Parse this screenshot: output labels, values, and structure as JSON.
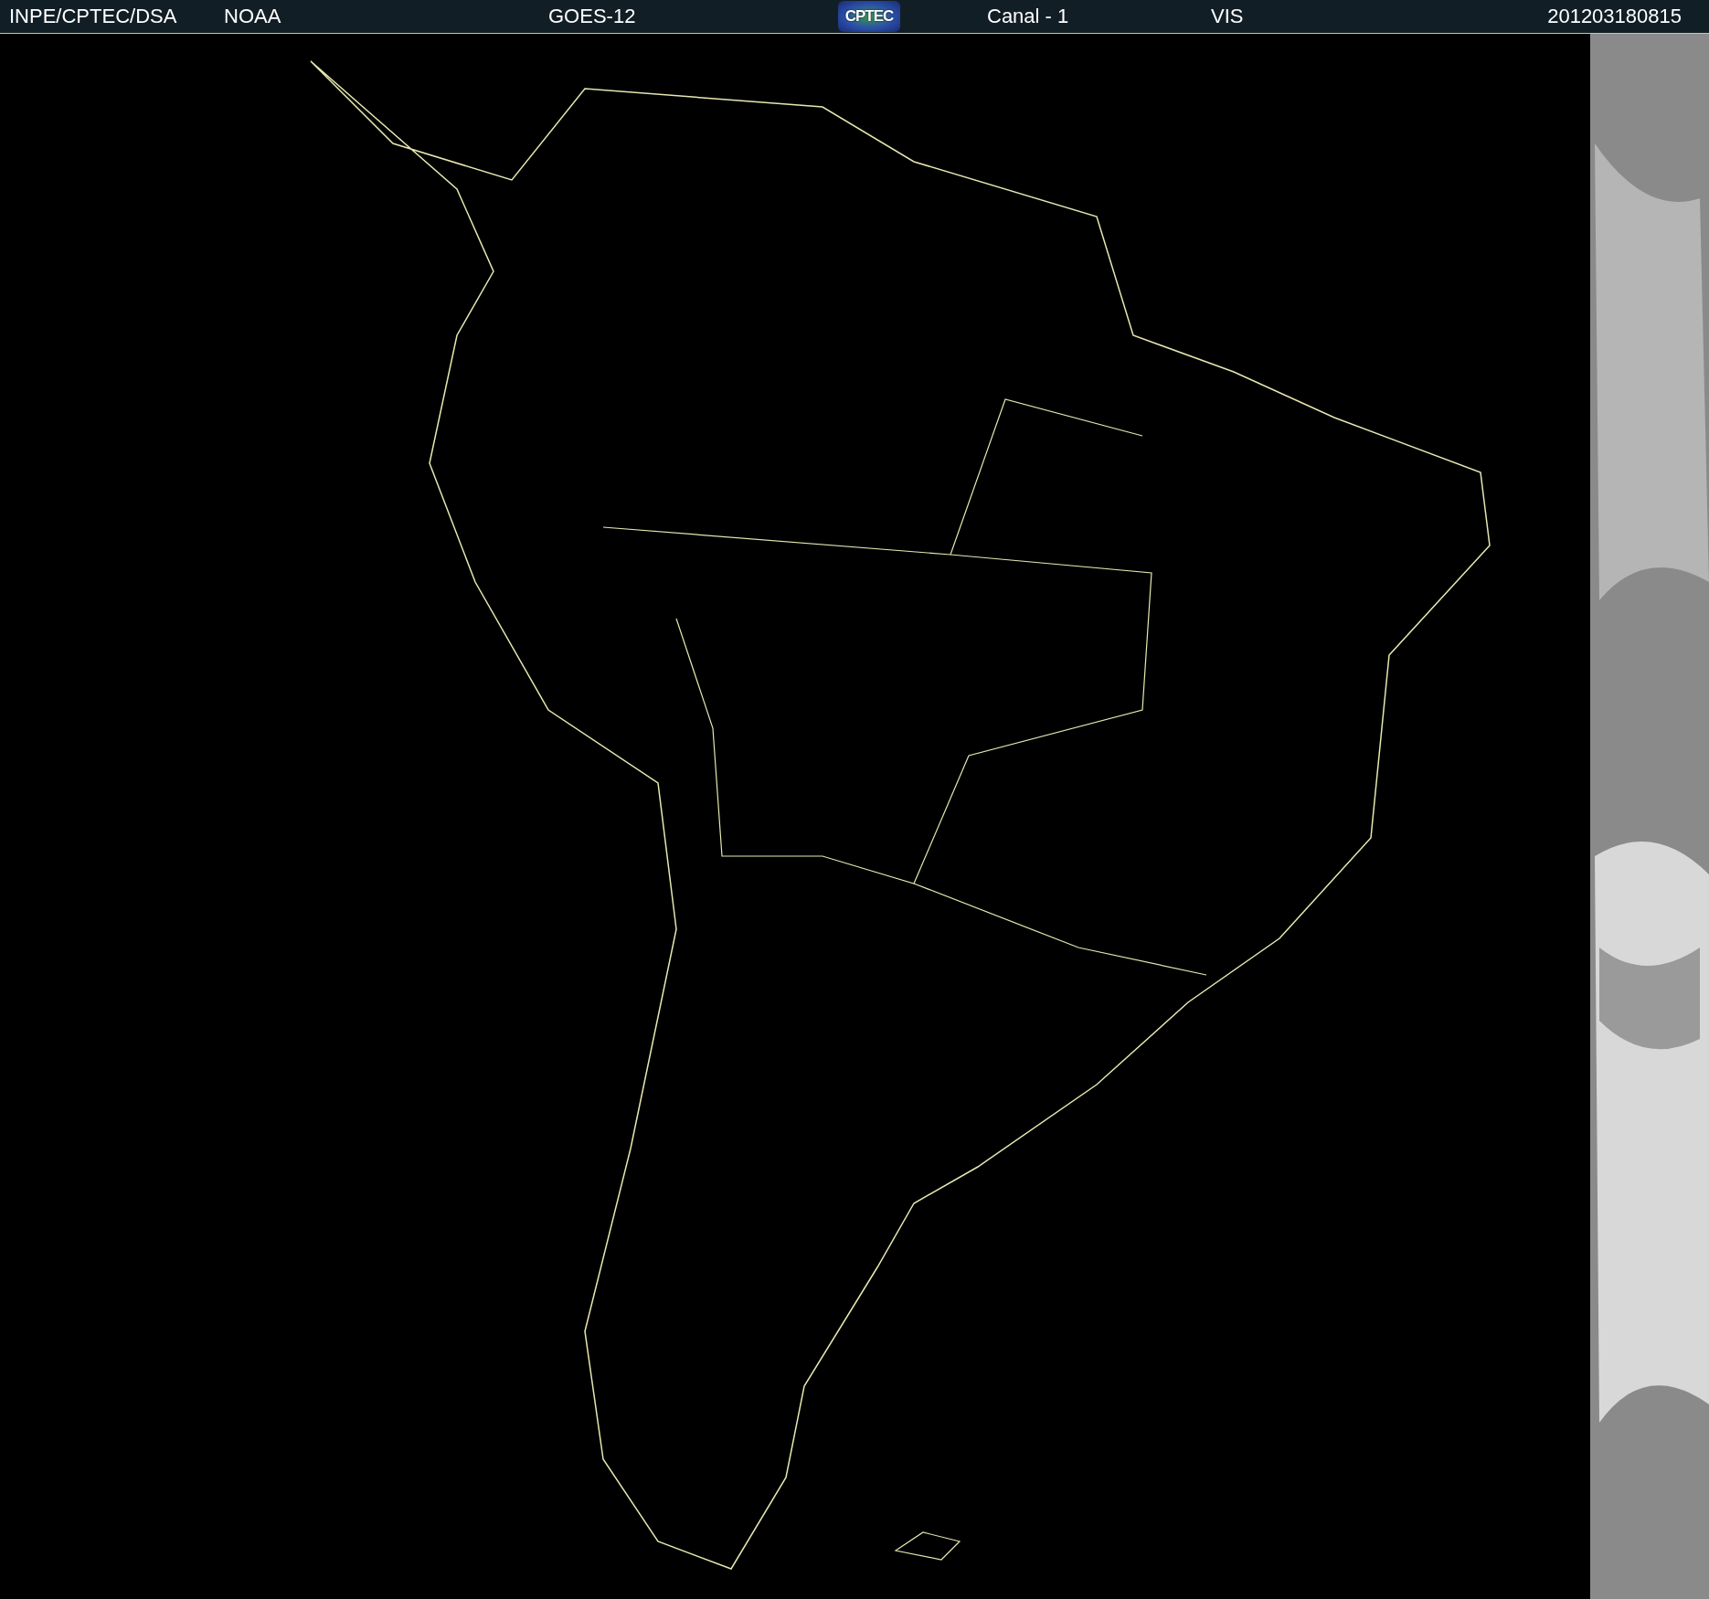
{
  "header": {
    "items": [
      {
        "kind": "text",
        "text": "INPE/CPTEC/DSA"
      },
      {
        "kind": "text",
        "text": "NOAA"
      },
      {
        "kind": "text",
        "text": "GOES-12"
      },
      {
        "kind": "logo",
        "text": "CPTEC"
      },
      {
        "kind": "text",
        "text": "Canal - 1"
      },
      {
        "kind": "text",
        "text": "VIS"
      },
      {
        "kind": "text",
        "text": "201203180815"
      }
    ]
  }
}
